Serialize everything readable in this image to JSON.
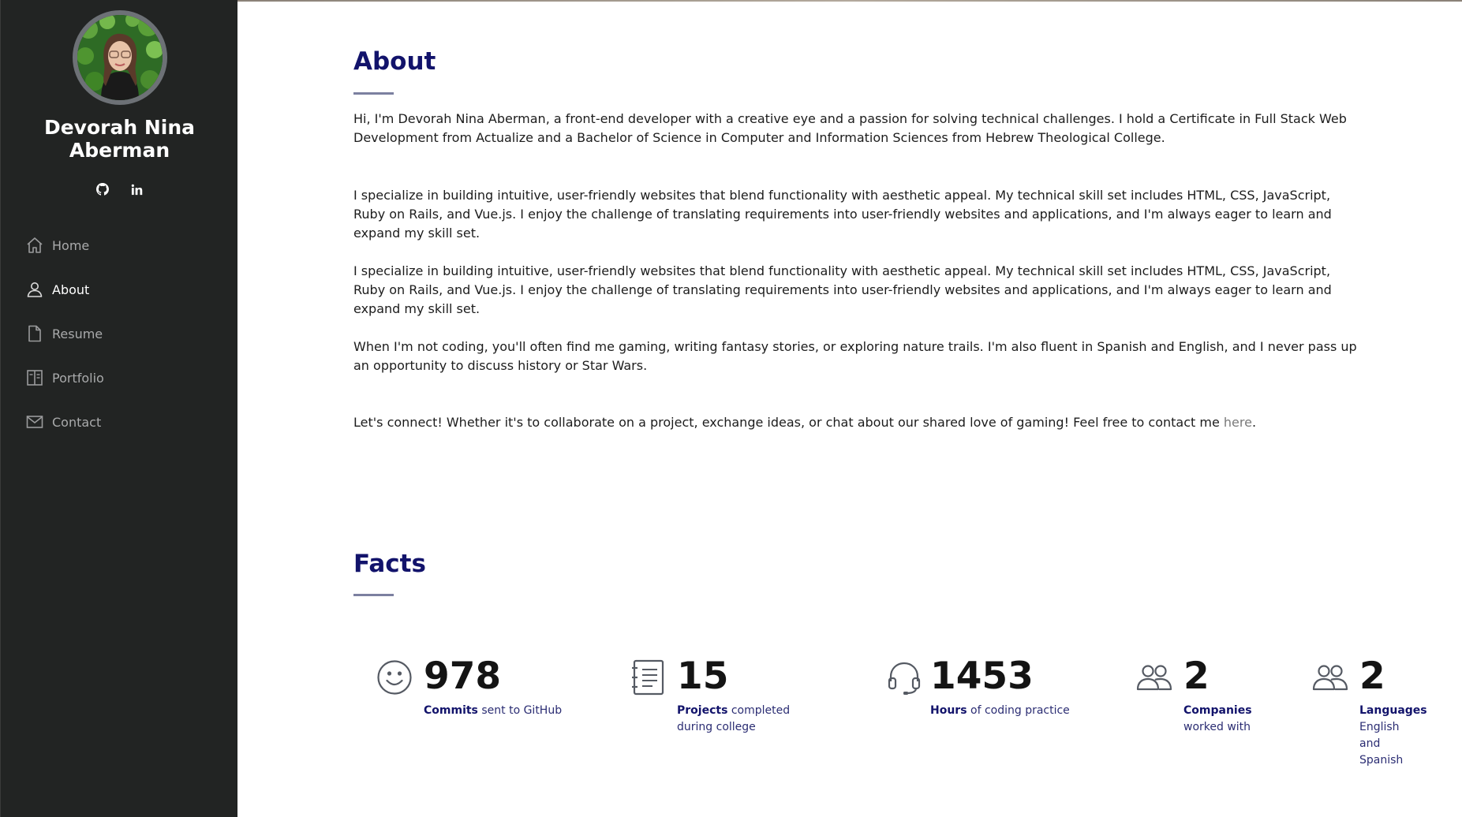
{
  "sidebar": {
    "name": "Devorah Nina Aberman",
    "social": [
      {
        "icon": "github-icon",
        "label": "GitHub"
      },
      {
        "icon": "linkedin-icon",
        "label": "in"
      }
    ],
    "nav": [
      {
        "label": "Home",
        "icon": "home-icon"
      },
      {
        "label": "About",
        "icon": "person-icon",
        "active": true
      },
      {
        "label": "Resume",
        "icon": "file-icon"
      },
      {
        "label": "Portfolio",
        "icon": "book-icon"
      },
      {
        "label": "Contact",
        "icon": "envelope-icon"
      }
    ]
  },
  "about": {
    "title": "About",
    "paragraphs": [
      "Hi, I'm Devorah Nina Aberman, a front-end developer with a creative eye and a passion for solving technical challenges. I hold a Certificate in Full Stack Web Development from Actualize and a Bachelor of Science in Computer and Information Sciences from Hebrew Theological College.",
      "I specialize in building intuitive, user-friendly websites that blend functionality with aesthetic appeal. My technical skill set includes HTML, CSS, JavaScript, Ruby on Rails, and Vue.js. I enjoy the challenge of translating requirements into user-friendly websites and applications, and I'm always eager to learn and expand my skill set.",
      "I specialize in building intuitive, user-friendly websites that blend functionality with aesthetic appeal. My technical skill set includes HTML, CSS, JavaScript, Ruby on Rails, and Vue.js. I enjoy the challenge of translating requirements into user-friendly websites and applications, and I'm always eager to learn and expand my skill set.",
      "When I'm not coding, you'll often find me gaming, writing fantasy stories, or exploring nature trails. I'm also fluent in Spanish and English, and I never pass up an opportunity to discuss history or Star Wars."
    ],
    "contact_text": "Let's connect! Whether it's to collaborate on a project, exchange ideas, or chat about our shared love of gaming! Feel free to contact me ",
    "contact_link": "here",
    "contact_end": "."
  },
  "facts": {
    "title": "Facts",
    "items": [
      {
        "icon": "smiley-icon",
        "number": "978",
        "bold": "Commits",
        "rest": " sent to GitHub"
      },
      {
        "icon": "journal-icon",
        "number": "15",
        "bold": "Projects",
        "rest": " completed during college"
      },
      {
        "icon": "headset-icon",
        "number": "1453",
        "bold": "Hours",
        "rest": " of coding practice"
      },
      {
        "icon": "people-icon",
        "number": "2",
        "bold": "Companies",
        "rest": " worked with"
      },
      {
        "icon": "people-icon",
        "number": "2",
        "bold": "Languages",
        "rest": " English and Spanish"
      }
    ]
  },
  "colors": {
    "sidebar_bg": "#222423",
    "title": "#12136b",
    "accent_bar": "#7c80a0",
    "fact_text": "#2b2d73"
  }
}
